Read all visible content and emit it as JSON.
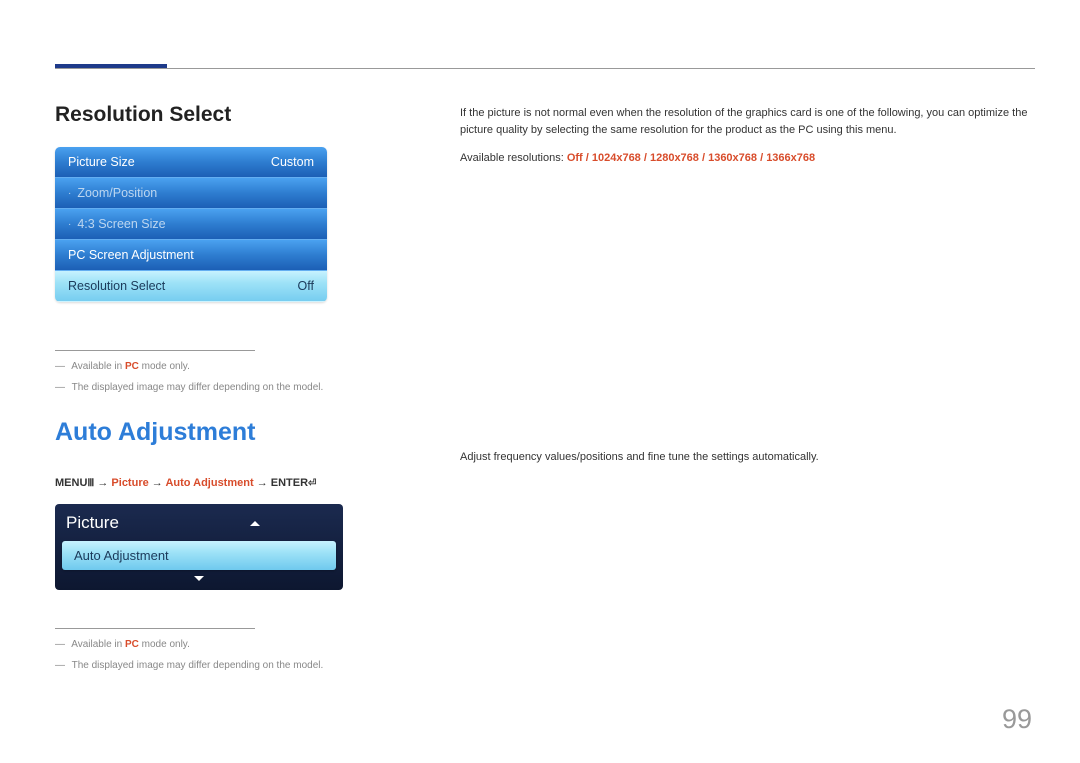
{
  "page_number": "99",
  "section1": {
    "title": "Resolution Select",
    "menu": [
      {
        "label": "Picture Size",
        "value": "Custom",
        "dim": false
      },
      {
        "label": "Zoom/Position",
        "value": "",
        "dim": true,
        "dot": true
      },
      {
        "label": "4:3 Screen Size",
        "value": "",
        "dim": true,
        "dot": true
      },
      {
        "label": "PC Screen Adjustment",
        "value": "",
        "dim": false
      },
      {
        "label": "Resolution Select",
        "value": "Off",
        "selected": true
      }
    ],
    "footnotes": {
      "a_pre": "Available in ",
      "a_pc": "PC",
      "a_post": " mode only.",
      "b": "The displayed image may differ depending on the model."
    }
  },
  "section1_right": {
    "desc": "If the picture is not normal even when the resolution of the graphics card is one of the following, you can optimize the picture quality by selecting the same resolution for the product as the PC using this menu.",
    "res_label": "Available resolutions: ",
    "res_values": "Off / 1024x768 / 1280x768 / 1360x768 / 1366x768"
  },
  "section2": {
    "title": "Auto Adjustment",
    "breadcrumb": {
      "menu": "MENU",
      "arrow": " → ",
      "picture": "Picture",
      "auto": "Auto Adjustment",
      "enter": "ENTER"
    },
    "picture_menu": {
      "header": "Picture",
      "item": "Auto Adjustment"
    },
    "footnotes": {
      "a_pre": "Available in ",
      "a_pc": "PC",
      "a_post": " mode only.",
      "b": "The displayed image may differ depending on the model."
    }
  },
  "section2_right": {
    "desc": "Adjust frequency values/positions and fine tune the settings automatically."
  }
}
